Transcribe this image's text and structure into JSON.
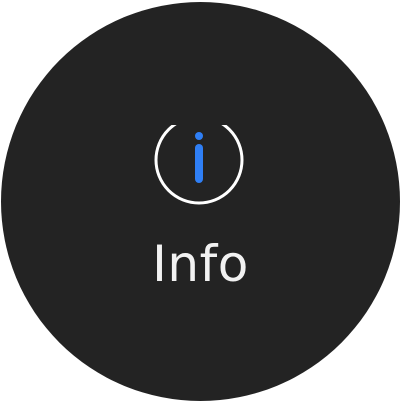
{
  "info_button": {
    "label": "Info",
    "icon": "info-icon",
    "colors": {
      "background": "#232323",
      "icon_ring": "#ffffff",
      "icon_accent": "#2f7ff5",
      "label": "#f2f2f2"
    }
  }
}
